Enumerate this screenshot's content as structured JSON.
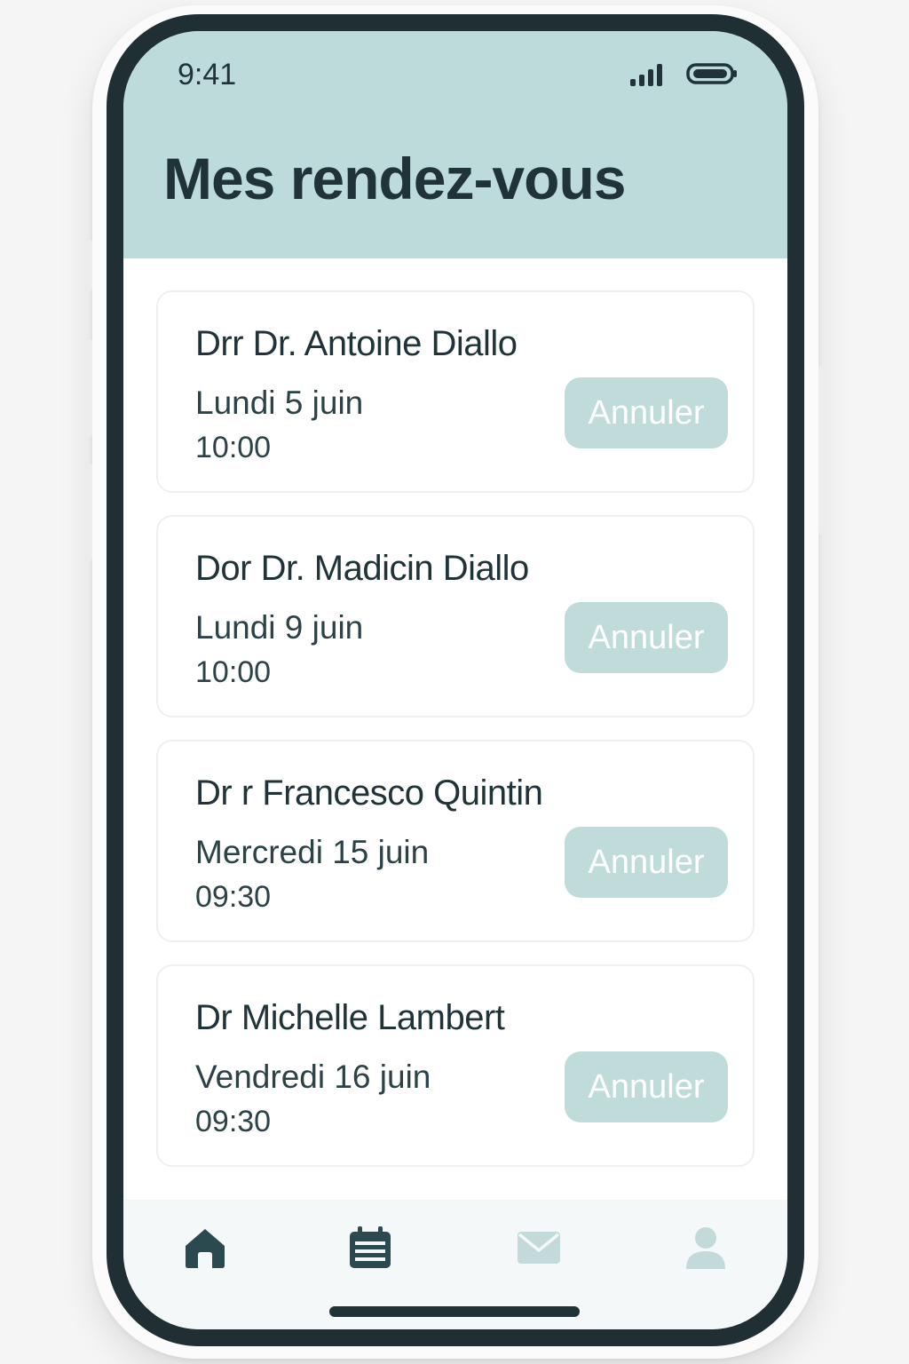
{
  "status_bar": {
    "time": "9:41",
    "signal_icon": "signal-bars-icon",
    "battery_icon": "battery-icon"
  },
  "header": {
    "title": "Mes rendez-vous"
  },
  "appointments": [
    {
      "doctor": "Drr Dr. Antoine Diallo",
      "date": "Lundi 5 juin",
      "time": "10:00",
      "action": "Annuler"
    },
    {
      "doctor": "Dor Dr. Madicin Diallo",
      "date": "Lundi 9 juin",
      "time": "10:00",
      "action": "Annuler"
    },
    {
      "doctor": "Dr r Francesco Quintin",
      "date": "Mercredi 15  juin",
      "time": "09:30",
      "action": "Annuler"
    },
    {
      "doctor": "Dr Michelle Lambert",
      "date": "Vendredi 16 juin",
      "time": "09:30",
      "action": "Annuler"
    }
  ],
  "tab_bar": {
    "tabs": [
      {
        "icon": "home-icon",
        "active": true
      },
      {
        "icon": "calendar-icon",
        "active": true
      },
      {
        "icon": "mail-icon",
        "active": false
      },
      {
        "icon": "profile-icon",
        "active": false
      }
    ]
  },
  "colors": {
    "header_bg": "#bddbda",
    "accent_button": "#bfdcdb",
    "text_dark": "#1f3338",
    "bezel": "#1f2f33"
  }
}
